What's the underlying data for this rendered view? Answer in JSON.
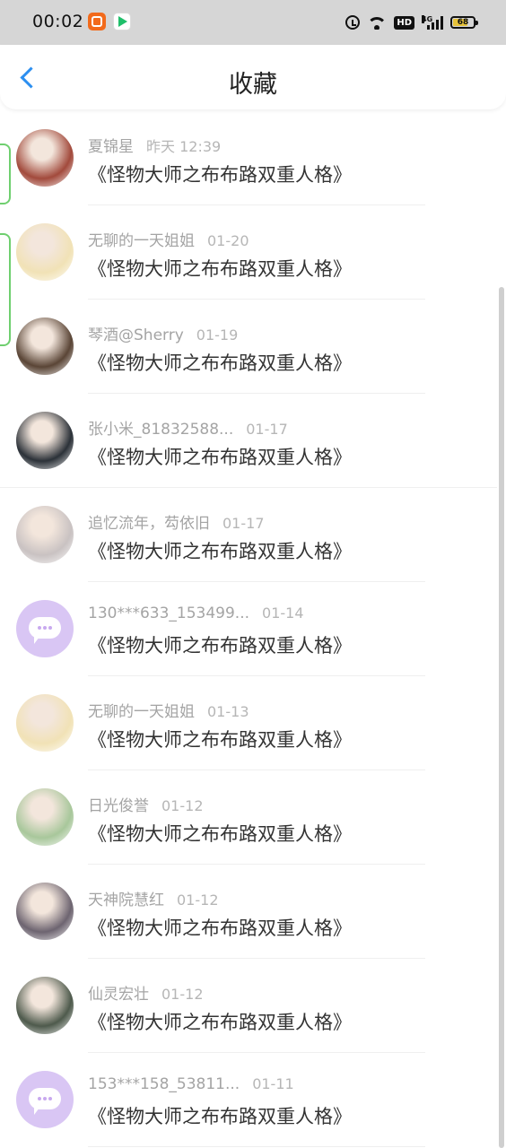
{
  "status_bar": {
    "time": "00:02",
    "icons": [
      "app-orange-icon",
      "video-app-icon",
      "alarm-icon",
      "wifi-icon",
      "hd-icon",
      "signal-4g-icon",
      "battery-icon"
    ],
    "hd": "HD",
    "network": "4G",
    "battery": "68"
  },
  "header": {
    "back_icon": "chevron-left-icon",
    "title": "收藏"
  },
  "items": [
    {
      "name": "夏锦星",
      "time": "昨天 12:39",
      "text": "《怪物大师之布布路双重人格》",
      "avatar": "photo",
      "avatar_color": "#a24a3c"
    },
    {
      "name": "无聊的一天姐姐",
      "time": "01-20",
      "text": "《怪物大师之布布路双重人格》",
      "avatar": "photo",
      "avatar_color": "#f1e2b6"
    },
    {
      "name": "琴酒@Sherry",
      "time": "01-19",
      "text": "《怪物大师之布布路双重人格》",
      "avatar": "photo",
      "avatar_color": "#5a4536"
    },
    {
      "name": "张小米_81832588...",
      "time": "01-17",
      "text": "《怪物大师之布布路双重人格》",
      "avatar": "photo",
      "avatar_color": "#2b3138"
    },
    {
      "name": "追忆流年，芶依旧",
      "time": "01-17",
      "text": "《怪物大师之布布路双重人格》",
      "avatar": "photo",
      "avatar_color": "#c9c2c2"
    },
    {
      "name": "130***633_153499...",
      "time": "01-14",
      "text": "《怪物大师之布布路双重人格》",
      "avatar": "default",
      "avatar_color": "#d9c6f4"
    },
    {
      "name": "无聊的一天姐姐",
      "time": "01-13",
      "text": "《怪物大师之布布路双重人格》",
      "avatar": "photo",
      "avatar_color": "#f1e2b6"
    },
    {
      "name": "日光俊誉",
      "time": "01-12",
      "text": "《怪物大师之布布路双重人格》",
      "avatar": "photo",
      "avatar_color": "#a8c79b"
    },
    {
      "name": "天神院慧红",
      "time": "01-12",
      "text": "《怪物大师之布布路双重人格》",
      "avatar": "photo",
      "avatar_color": "#6d6470"
    },
    {
      "name": "仙灵宏壮",
      "time": "01-12",
      "text": "《怪物大师之布布路双重人格》",
      "avatar": "photo",
      "avatar_color": "#4e5a4c"
    },
    {
      "name": "153***158_53811...",
      "time": "01-11",
      "text": "《怪物大师之布布路双重人格》",
      "avatar": "default",
      "avatar_color": "#d9c6f4"
    }
  ]
}
